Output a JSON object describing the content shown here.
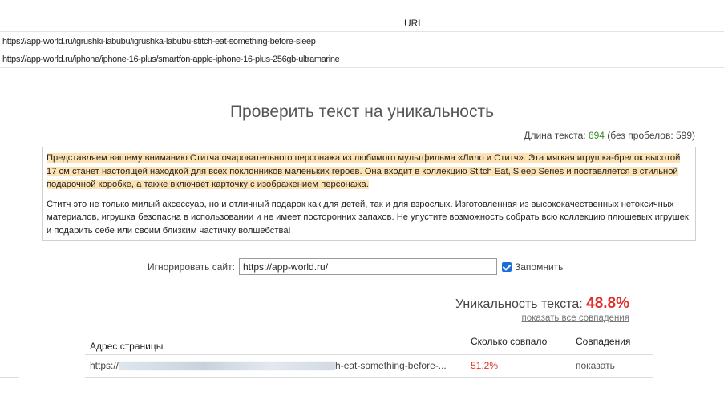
{
  "sheet": {
    "header": "URL",
    "rows": [
      "https://app-world.ru/igrushki-labubu/igrushka-labubu-stitch-eat-something-before-sleep",
      "https://app-world.ru/iphone/iphone-16-plus/smartfon-apple-iphone-16-plus-256gb-ultramarine"
    ]
  },
  "checker": {
    "title": "Проверить текст на уникальность",
    "length_label": "Длина текста: ",
    "length_value": "694",
    "length_no_spaces": " (без пробелов: 599)",
    "paragraph1": "Представляем вашему вниманию Ститча очаровательного персонажа из любимого мультфильма «Лило и Ститч». Эта мягкая игрушка-брелок высотой 17 см станет настоящей находкой для всех поклонников маленьких героев. Она входит в коллекцию Stitch Eat, Sleep Series и поставляется в стильной подарочной коробке, а также включает карточку с изображением персонажа.",
    "paragraph2": "Ститч это не только милый аксессуар, но и отличный подарок как для детей, так и для взрослых. Изготовленная из высококачественных нетоксичных материалов, игрушка безопасна в использовании и не имеет посторонних запахов. Не упустите возможность собрать всю коллекцию плюшевых игрушек и подарить себе или своим близким частичку волшебства!",
    "ignore_label": "Игнорировать сайт:",
    "ignore_value": "https://app-world.ru/",
    "remember_label": "Запомнить",
    "remember_checked": true
  },
  "result": {
    "uniqueness_label": "Уникальность текста: ",
    "uniqueness_value": "48.8%",
    "show_all_link": "показать все совпадения",
    "columns": [
      "Адрес страницы",
      "Сколько совпало",
      "Совпадения"
    ],
    "rows": [
      {
        "url_start": "https://",
        "url_end": "h-eat-something-before-...",
        "match": "51.2%",
        "action": "показать"
      }
    ]
  },
  "colors": {
    "highlight": "#fde3b4",
    "uniqueness": "#e0302b",
    "length_number": "#3a8a2a",
    "checkbox": "#1a6cd8"
  }
}
